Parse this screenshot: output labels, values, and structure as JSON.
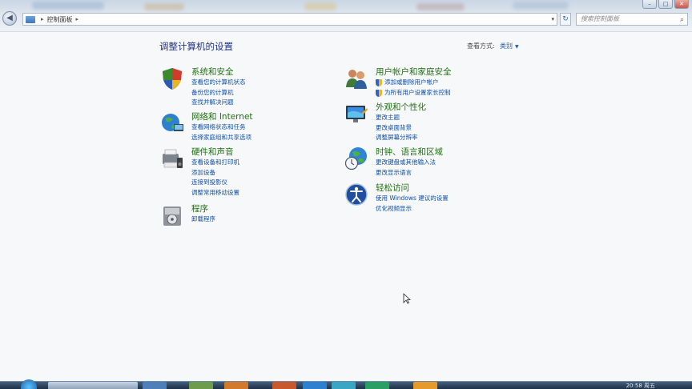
{
  "window": {
    "controls": [
      "–",
      "□",
      "✕"
    ]
  },
  "address": {
    "path": [
      "控制面板"
    ],
    "separator": "▸",
    "dropdown": "▾"
  },
  "search": {
    "placeholder": "搜索控制面板",
    "icon": "magnifier-icon"
  },
  "header": {
    "title": "调整计算机的设置",
    "view_by_label": "查看方式:",
    "view_by_value": "类别",
    "view_by_caret": "▼"
  },
  "categories": [
    {
      "title": "系统和安全",
      "icon": "system-security-icon",
      "links": [
        "查看您的计算机状态",
        "备份您的计算机",
        "查找并解决问题"
      ]
    },
    {
      "title": "网络和 Internet",
      "icon": "network-icon",
      "links": [
        "查看网络状态和任务",
        "选择家庭组和共享选项"
      ]
    },
    {
      "title": "硬件和声音",
      "icon": "hardware-sound-icon",
      "links": [
        "查看设备和打印机",
        "添加设备",
        "连接到投影仪",
        "调整常用移动设置"
      ]
    },
    {
      "title": "程序",
      "icon": "programs-icon",
      "links": [
        "卸载程序"
      ]
    },
    {
      "title": "用户帐户和家庭安全",
      "icon": "user-accounts-icon",
      "links": [
        "添加或删除用户帐户",
        "为所有用户设置家长控制"
      ]
    },
    {
      "title": "外观和个性化",
      "icon": "appearance-icon",
      "links": [
        "更改主题",
        "更改桌面背景",
        "调整屏幕分辨率"
      ]
    },
    {
      "title": "时钟、语言和区域",
      "icon": "clock-language-region-icon",
      "links": [
        "更改键盘或其他输入法",
        "更改显示语言"
      ]
    },
    {
      "title": "轻松访问",
      "icon": "ease-of-access-icon",
      "links": [
        "使用 Windows 建议的设置",
        "优化视频显示"
      ]
    }
  ],
  "taskbar": {
    "clock": "20:58 周五"
  },
  "colors": {
    "title_blue": "#1e3287",
    "category_green": "#217014",
    "link_blue": "#0e4fa6"
  }
}
